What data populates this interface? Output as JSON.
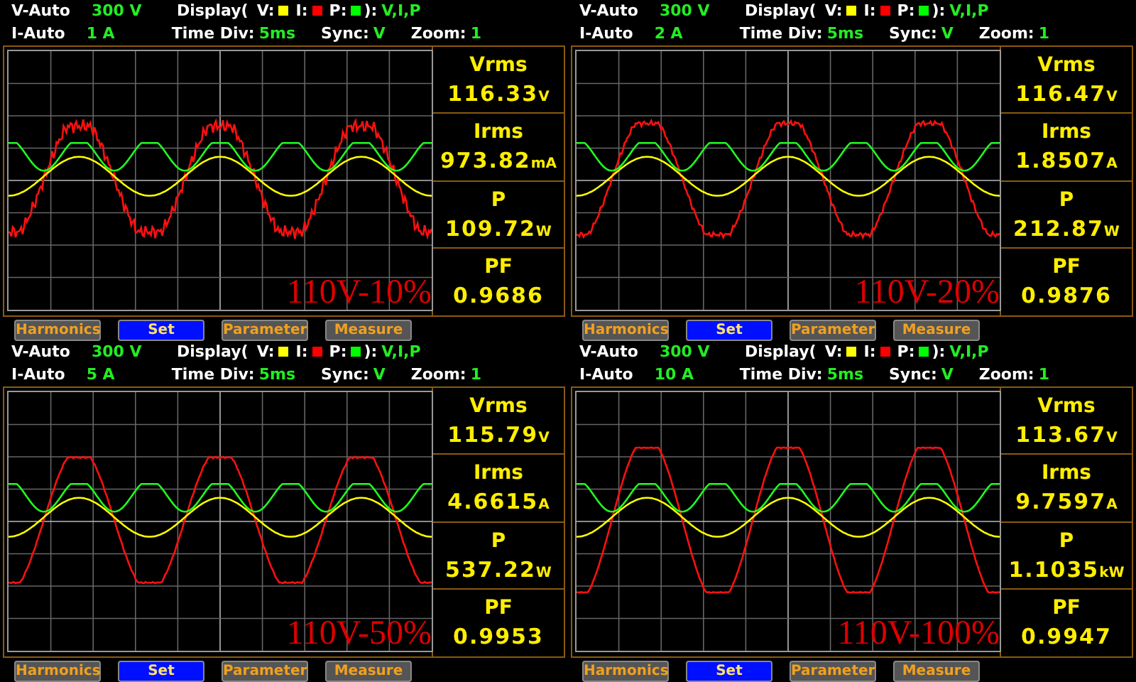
{
  "panels": [
    {
      "v_range": {
        "label": "V-Auto",
        "value": "300 V"
      },
      "i_range": {
        "label": "I-Auto",
        "value": "1 A"
      },
      "display": {
        "prefix": "Display(",
        "channels": [
          {
            "label": "V:",
            "color": "#ffff00"
          },
          {
            "label": "I:",
            "color": "#ff0000"
          },
          {
            "label": "P:",
            "color": "#00ff00"
          }
        ],
        "suffix": "):",
        "value": "V,I,P"
      },
      "time_div": {
        "label": "Time  Div:",
        "value": "5ms"
      },
      "sync": {
        "label": "Sync:",
        "value": "V"
      },
      "zoom": {
        "label": "Zoom:",
        "value": "1"
      },
      "overlay": "110V-10%",
      "measurements": [
        {
          "label": "Vrms",
          "value": "116.33",
          "unit": "V"
        },
        {
          "label": "Irms",
          "value": "973.82",
          "unit": "mA"
        },
        {
          "label": "P",
          "value": "109.72",
          "unit": "W"
        },
        {
          "label": "PF",
          "value": "0.9686"
        }
      ],
      "buttons": [
        {
          "label": "Harmonics",
          "selected": false
        },
        {
          "label": "Set",
          "selected": true
        },
        {
          "label": "Parameter",
          "selected": false
        },
        {
          "label": "Measure",
          "selected": false
        }
      ]
    },
    {
      "v_range": {
        "label": "V-Auto",
        "value": "300 V"
      },
      "i_range": {
        "label": "I-Auto",
        "value": "2 A"
      },
      "display": {
        "prefix": "Display(",
        "channels": [
          {
            "label": "V:",
            "color": "#ffff00"
          },
          {
            "label": "I:",
            "color": "#ff0000"
          },
          {
            "label": "P:",
            "color": "#00ff00"
          }
        ],
        "suffix": "):",
        "value": "V,I,P"
      },
      "time_div": {
        "label": "Time  Div:",
        "value": "5ms"
      },
      "sync": {
        "label": "Sync:",
        "value": "V"
      },
      "zoom": {
        "label": "Zoom:",
        "value": "1"
      },
      "overlay": "110V-20%",
      "measurements": [
        {
          "label": "Vrms",
          "value": "116.47",
          "unit": "V"
        },
        {
          "label": "Irms",
          "value": "1.8507",
          "unit": "A"
        },
        {
          "label": "P",
          "value": "212.87",
          "unit": "W"
        },
        {
          "label": "PF",
          "value": "0.9876"
        }
      ],
      "buttons": [
        {
          "label": "Harmonics",
          "selected": false
        },
        {
          "label": "Set",
          "selected": true
        },
        {
          "label": "Parameter",
          "selected": false
        },
        {
          "label": "Measure",
          "selected": false
        }
      ]
    },
    {
      "v_range": {
        "label": "V-Auto",
        "value": "300 V"
      },
      "i_range": {
        "label": "I-Auto",
        "value": "5 A"
      },
      "display": {
        "prefix": "Display(",
        "channels": [
          {
            "label": "V:",
            "color": "#ffff00"
          },
          {
            "label": "I:",
            "color": "#ff0000"
          },
          {
            "label": "P:",
            "color": "#00ff00"
          }
        ],
        "suffix": "):",
        "value": "V,I,P"
      },
      "time_div": {
        "label": "Time  Div:",
        "value": "5ms"
      },
      "sync": {
        "label": "Sync:",
        "value": "V"
      },
      "zoom": {
        "label": "Zoom:",
        "value": "1"
      },
      "overlay": "110V-50%",
      "measurements": [
        {
          "label": "Vrms",
          "value": "115.79",
          "unit": "V"
        },
        {
          "label": "Irms",
          "value": "4.6615",
          "unit": "A"
        },
        {
          "label": "P",
          "value": "537.22",
          "unit": "W"
        },
        {
          "label": "PF",
          "value": "0.9953"
        }
      ],
      "buttons": [
        {
          "label": "Harmonics",
          "selected": false
        },
        {
          "label": "Set",
          "selected": true
        },
        {
          "label": "Parameter",
          "selected": false
        },
        {
          "label": "Measure",
          "selected": false
        }
      ]
    },
    {
      "v_range": {
        "label": "V-Auto",
        "value": "300 V"
      },
      "i_range": {
        "label": "I-Auto",
        "value": "10 A"
      },
      "display": {
        "prefix": "Display(",
        "channels": [
          {
            "label": "V:",
            "color": "#ffff00"
          },
          {
            "label": "I:",
            "color": "#ff0000"
          },
          {
            "label": "P:",
            "color": "#00ff00"
          }
        ],
        "suffix": "):",
        "value": "V,I,P"
      },
      "time_div": {
        "label": "Time  Div:",
        "value": "5ms"
      },
      "sync": {
        "label": "Sync:",
        "value": "V"
      },
      "zoom": {
        "label": "Zoom:",
        "value": "1"
      },
      "overlay": "110V-100%",
      "measurements": [
        {
          "label": "Vrms",
          "value": "113.67",
          "unit": "V"
        },
        {
          "label": "Irms",
          "value": "9.7597",
          "unit": "A"
        },
        {
          "label": "P",
          "value": "1.1035",
          "unit": "kW"
        },
        {
          "label": "PF",
          "value": "0.9947"
        }
      ],
      "buttons": [
        {
          "label": "Harmonics",
          "selected": false
        },
        {
          "label": "Set",
          "selected": true
        },
        {
          "label": "Parameter",
          "selected": false
        },
        {
          "label": "Measure",
          "selected": false
        }
      ]
    }
  ]
}
